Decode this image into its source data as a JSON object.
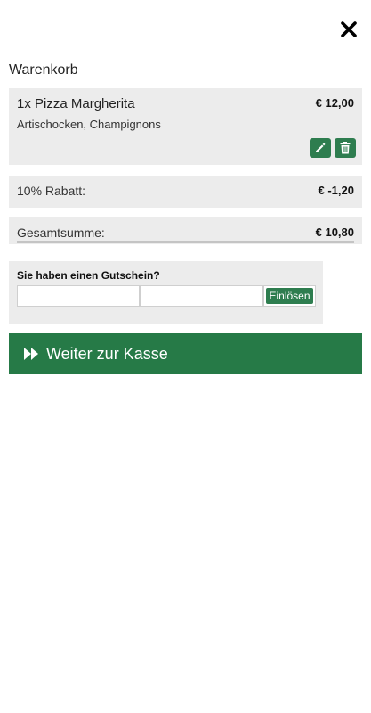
{
  "header": {
    "close_icon": "close-icon"
  },
  "cart": {
    "title": "Warenkorb",
    "items": [
      {
        "name": "1x Pizza Margherita",
        "price": "€ 12,00",
        "toppings": "Artischocken, Champignons",
        "edit_icon": "pencil-icon",
        "delete_icon": "trash-icon"
      }
    ],
    "discount": {
      "label": "10% Rabatt:",
      "value": "€ -1,20"
    },
    "total": {
      "label": "Gesamtsumme:",
      "value": "€ 10,80"
    }
  },
  "voucher": {
    "title": "Sie haben einen Gutschein?",
    "input1_value": "",
    "input2_value": "",
    "redeem_label": "Einlösen"
  },
  "checkout": {
    "label": "Weiter zur Kasse",
    "icon": "fast-forward-icon"
  },
  "colors": {
    "accent": "#267a47",
    "card_bg": "#ececec"
  }
}
